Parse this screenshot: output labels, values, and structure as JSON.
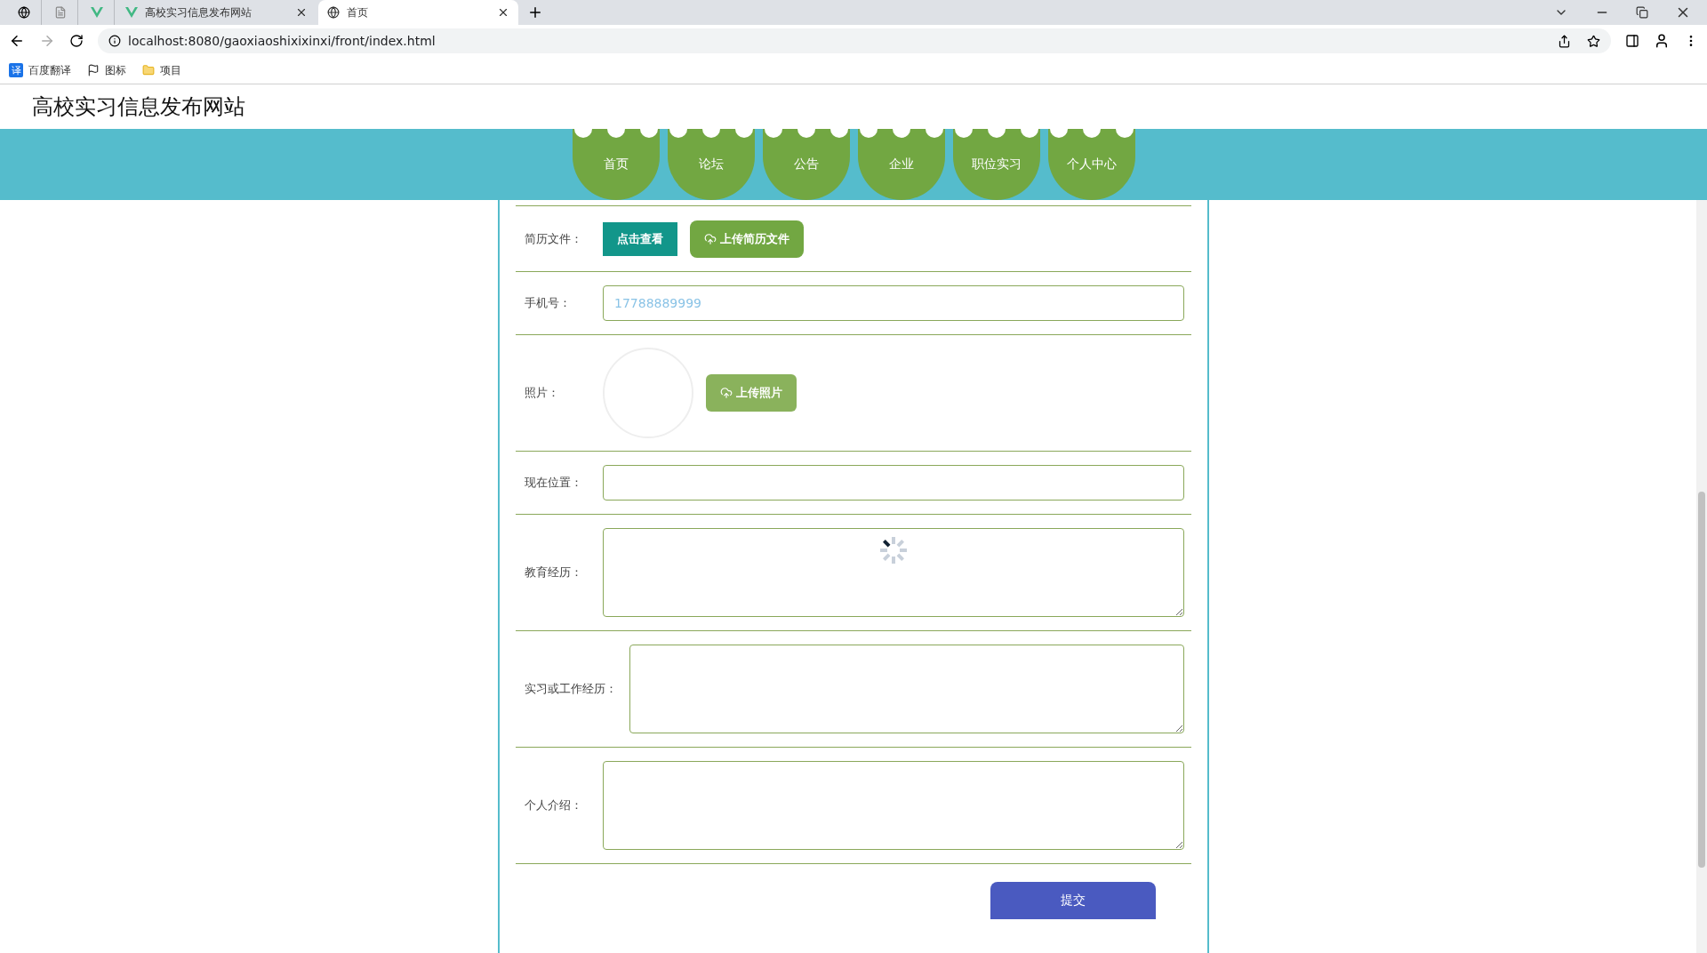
{
  "browser": {
    "tabs": [
      {
        "kind": "vue",
        "title": "高校实习信息发布网站",
        "selected": false
      },
      {
        "kind": "globe",
        "title": "首页",
        "selected": true
      }
    ],
    "address": "localhost:8080/gaoxiaoshixixinxi/front/index.html",
    "bookmarks": [
      {
        "kind": "translate",
        "label": "百度翻译",
        "badge": "译"
      },
      {
        "kind": "flag",
        "label": "图标"
      },
      {
        "kind": "folder",
        "label": "项目"
      }
    ]
  },
  "site": {
    "title": "高校实习信息发布网站",
    "nav": [
      "首页",
      "论坛",
      "公告",
      "企业",
      "职位实习",
      "个人中心"
    ]
  },
  "form": {
    "rows": [
      {
        "kind": "file",
        "label": "简历文件：",
        "buttons": [
          "点击查看",
          "上传简历文件"
        ]
      },
      {
        "kind": "input",
        "label": "手机号：",
        "value": "17788889999"
      },
      {
        "kind": "photo",
        "label": "照片：",
        "button": "上传照片"
      },
      {
        "kind": "input",
        "label": "现在位置："
      },
      {
        "kind": "textarea",
        "label": "教育经历：",
        "loading": true
      },
      {
        "kind": "textarea",
        "label": "实习或工作经历：",
        "loading": false
      },
      {
        "kind": "textarea",
        "label": "个人介绍：",
        "loading": false
      }
    ],
    "submit": "提交"
  }
}
